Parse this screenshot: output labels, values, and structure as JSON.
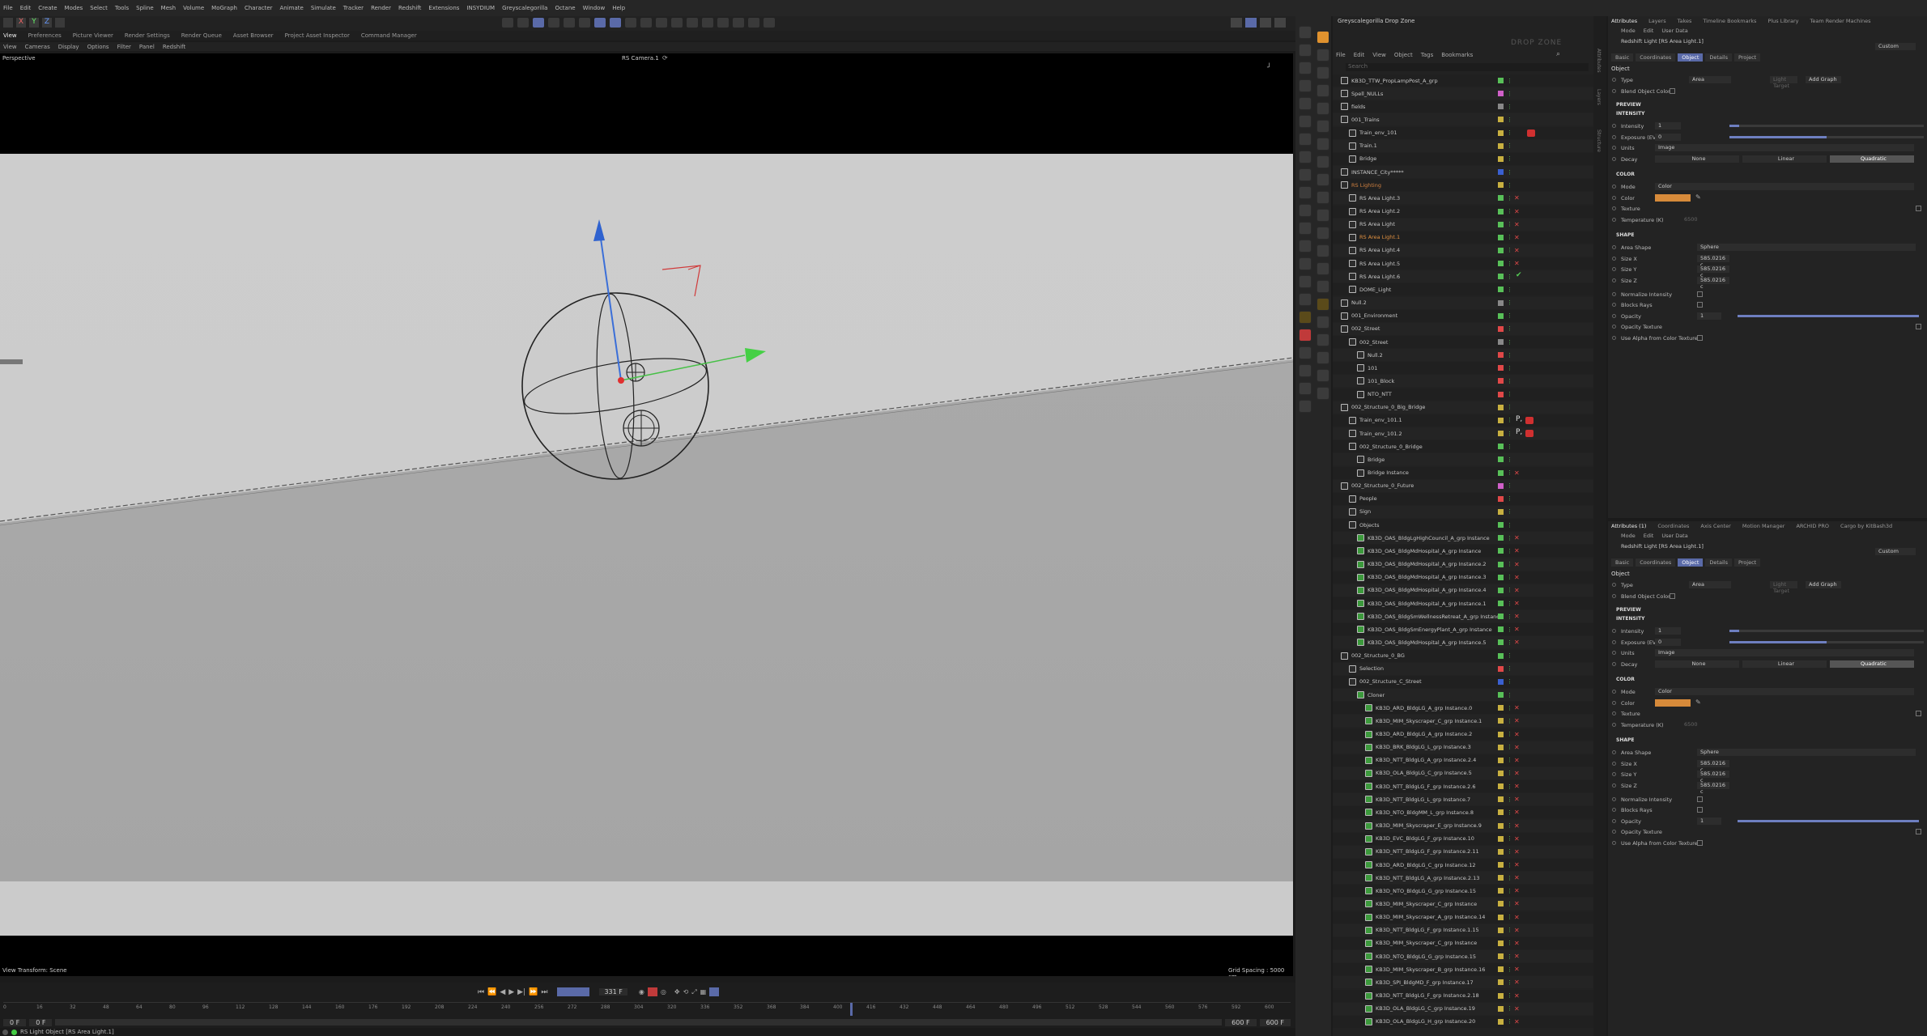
{
  "menu": [
    "File",
    "Edit",
    "Create",
    "Modes",
    "Select",
    "Tools",
    "Spline",
    "Mesh",
    "Volume",
    "MoGraph",
    "Character",
    "Animate",
    "Simulate",
    "Tracker",
    "Render",
    "Redshift",
    "Extensions",
    "INSYDIUM",
    "Greyscalegorilla",
    "Octane",
    "Window",
    "Help"
  ],
  "tabs": [
    "View",
    "Preferences",
    "Picture Viewer",
    "Render Settings",
    "Render Queue",
    "Asset Browser",
    "Project Asset Inspector",
    "Command Manager"
  ],
  "viewport": {
    "menu": [
      "View",
      "Cameras",
      "Display",
      "Options",
      "Filter",
      "Panel",
      "Redshift"
    ],
    "label": "Perspective",
    "camera": "RS Camera.1",
    "status": "View Transform: Scene",
    "grid": "Grid Spacing : 5000 cm"
  },
  "timeline": {
    "frame": "331 F",
    "ticks": [
      "0",
      "16",
      "32",
      "48",
      "64",
      "80",
      "96",
      "112",
      "128",
      "144",
      "160",
      "176",
      "192",
      "208",
      "224",
      "240",
      "256",
      "272",
      "288",
      "304",
      "320",
      "336",
      "352",
      "368",
      "384",
      "400",
      "416",
      "432",
      "448",
      "464",
      "480",
      "496",
      "512",
      "528",
      "544",
      "560",
      "576",
      "592",
      "600"
    ],
    "start": "0 F",
    "start2": "0 F",
    "end": "600 F",
    "end2": "600 F"
  },
  "statusbar": "RS Light Object [RS Area Light.1]",
  "om": {
    "title": "Greyscalegorilla Drop Zone",
    "menu": [
      "File",
      "Edit",
      "View",
      "Object",
      "Tags",
      "Bookmarks"
    ],
    "search": "Search",
    "dropzone": "DROP ZONE"
  },
  "objects": [
    {
      "n": "KB3D_TTW_PropLampPost_A_grp",
      "d": 0,
      "c": "#58c058",
      "x": false
    },
    {
      "n": "Spell_NULLs",
      "d": 0,
      "c": "#d060c8",
      "x": false
    },
    {
      "n": "fields",
      "d": 0,
      "c": "#888888",
      "x": false
    },
    {
      "n": "001_Trains",
      "d": 0,
      "c": "#c8b040",
      "x": false
    },
    {
      "n": "Train_env_101",
      "d": 1,
      "c": "#c8b040",
      "x": false
    },
    {
      "n": "Train.1",
      "d": 1,
      "c": "#c8b040",
      "x": false
    },
    {
      "n": "Bridge",
      "d": 1,
      "c": "#c8b040",
      "x": false
    },
    {
      "n": "INSTANCE_City*****",
      "d": 0,
      "c": "#3a60d0",
      "x": false
    },
    {
      "n": "RS Lighting",
      "d": 0,
      "c": "#c8b040",
      "x": false,
      "hl": "#d08040"
    },
    {
      "n": "RS Area Light.3",
      "d": 1,
      "c": "#58c058",
      "x": true
    },
    {
      "n": "RS Area Light.2",
      "d": 1,
      "c": "#58c058",
      "x": true
    },
    {
      "n": "RS Area Light",
      "d": 1,
      "c": "#58c058",
      "x": true
    },
    {
      "n": "RS Area Light.1",
      "d": 1,
      "c": "#58c058",
      "x": true,
      "hl": "#e09040"
    },
    {
      "n": "RS Area Light.4",
      "d": 1,
      "c": "#58c058",
      "x": true
    },
    {
      "n": "RS Area Light.5",
      "d": 1,
      "c": "#58c058",
      "x": true
    },
    {
      "n": "RS Area Light.6",
      "d": 1,
      "c": "#58c058",
      "x": false
    },
    {
      "n": "DOME_Light",
      "d": 1,
      "c": "#58c058",
      "x": false
    },
    {
      "n": "Null.2",
      "d": 0,
      "c": "#888888",
      "x": false
    },
    {
      "n": "001_Environment",
      "d": 0,
      "c": "#58c058",
      "x": false
    },
    {
      "n": "002_Street",
      "d": 0,
      "c": "#e04848",
      "x": false
    },
    {
      "n": "002_Street",
      "d": 1,
      "c": "#888888",
      "x": false
    },
    {
      "n": "Null.2",
      "d": 2,
      "c": "#e04848",
      "x": false
    },
    {
      "n": "101",
      "d": 2,
      "c": "#e04848",
      "x": false
    },
    {
      "n": "101_Block",
      "d": 2,
      "c": "#e04848",
      "x": false
    },
    {
      "n": "NTO_NTT",
      "d": 2,
      "c": "#e04848",
      "x": false
    },
    {
      "n": "002_Structure_0_Big_Bridge",
      "d": 0,
      "c": "#c8b040",
      "x": false
    },
    {
      "n": "Train_env_101.1",
      "d": 1,
      "c": "#c8b040",
      "x": false
    },
    {
      "n": "Train_env_101.2",
      "d": 1,
      "c": "#c8b040",
      "x": false
    },
    {
      "n": "002_Structure_0_Bridge",
      "d": 1,
      "c": "#58c058",
      "x": false
    },
    {
      "n": "Bridge",
      "d": 2,
      "c": "#58c058",
      "x": false
    },
    {
      "n": "Bridge Instance",
      "d": 2,
      "c": "#58c058",
      "x": true
    },
    {
      "n": "002_Structure_0_Future",
      "d": 0,
      "c": "#d060c8",
      "x": false
    },
    {
      "n": "People",
      "d": 1,
      "c": "#e04848",
      "x": false
    },
    {
      "n": "Sign",
      "d": 1,
      "c": "#c8b040",
      "x": false
    },
    {
      "n": "Objects",
      "d": 1,
      "c": "#58c058",
      "x": false
    },
    {
      "n": "KB3D_OAS_BldgLgHighCouncil_A_grp Instance",
      "d": 2,
      "c": "#58c058",
      "x": true
    },
    {
      "n": "KB3D_OAS_BldgMdHospital_A_grp Instance",
      "d": 2,
      "c": "#58c058",
      "x": true
    },
    {
      "n": "KB3D_OAS_BldgMdHospital_A_grp Instance.2",
      "d": 2,
      "c": "#58c058",
      "x": true
    },
    {
      "n": "KB3D_OAS_BldgMdHospital_A_grp Instance.3",
      "d": 2,
      "c": "#58c058",
      "x": true
    },
    {
      "n": "KB3D_OAS_BldgMdHospital_A_grp Instance.4",
      "d": 2,
      "c": "#58c058",
      "x": true
    },
    {
      "n": "KB3D_OAS_BldgMdHospital_A_grp Instance.1",
      "d": 2,
      "c": "#58c058",
      "x": true
    },
    {
      "n": "KB3D_OAS_BldgSmWellnessRetreat_A_grp Instance.1",
      "d": 2,
      "c": "#58c058",
      "x": true
    },
    {
      "n": "KB3D_OAS_BldgSmEnergyPlant_A_grp Instance",
      "d": 2,
      "c": "#58c058",
      "x": true
    },
    {
      "n": "KB3D_OAS_BldgMdHospital_A_grp Instance.5",
      "d": 2,
      "c": "#58c058",
      "x": true
    },
    {
      "n": "002_Structure_0_BG",
      "d": 0,
      "c": "#58c058",
      "x": false
    },
    {
      "n": "Selection",
      "d": 1,
      "c": "#e04848",
      "x": false
    },
    {
      "n": "002_Structure_C_Street",
      "d": 1,
      "c": "#3a60d0",
      "x": false
    },
    {
      "n": "Cloner",
      "d": 2,
      "c": "#58c058",
      "x": false
    },
    {
      "n": "KB3D_ARD_BldgLG_A_grp Instance.0",
      "d": 3,
      "c": "#c8b040",
      "x": true
    },
    {
      "n": "KB3D_MIM_Skyscraper_C_grp Instance.1",
      "d": 3,
      "c": "#c8b040",
      "x": true
    },
    {
      "n": "KB3D_ARD_BldgLG_A_grp Instance.2",
      "d": 3,
      "c": "#c8b040",
      "x": true
    },
    {
      "n": "KB3D_BRK_BldgLG_L_grp Instance.3",
      "d": 3,
      "c": "#c8b040",
      "x": true
    },
    {
      "n": "KB3D_NTT_BldgLG_A_grp Instance.2.4",
      "d": 3,
      "c": "#c8b040",
      "x": true
    },
    {
      "n": "KB3D_OLA_BldgLG_C_grp Instance.5",
      "d": 3,
      "c": "#c8b040",
      "x": true
    },
    {
      "n": "KB3D_NTT_BldgLG_F_grp Instance.2.6",
      "d": 3,
      "c": "#c8b040",
      "x": true
    },
    {
      "n": "KB3D_NTT_BldgLG_L_grp Instance.7",
      "d": 3,
      "c": "#c8b040",
      "x": true
    },
    {
      "n": "KB3D_NTO_BldgMM_L_grp Instance.8",
      "d": 3,
      "c": "#c8b040",
      "x": true
    },
    {
      "n": "KB3D_MIM_Skyscraper_E_grp Instance.9",
      "d": 3,
      "c": "#c8b040",
      "x": true
    },
    {
      "n": "KB3D_EVC_BldgLG_F_grp Instance.10",
      "d": 3,
      "c": "#c8b040",
      "x": true
    },
    {
      "n": "KB3D_NTT_BldgLG_F_grp Instance.2.11",
      "d": 3,
      "c": "#c8b040",
      "x": true
    },
    {
      "n": "KB3D_ARD_BldgLG_C_grp Instance.12",
      "d": 3,
      "c": "#c8b040",
      "x": true
    },
    {
      "n": "KB3D_NTT_BldgLG_A_grp Instance.2.13",
      "d": 3,
      "c": "#c8b040",
      "x": true
    },
    {
      "n": "KB3D_NTO_BldgLG_G_grp Instance.15",
      "d": 3,
      "c": "#c8b040",
      "x": true
    },
    {
      "n": "KB3D_MIM_Skyscraper_C_grp Instance",
      "d": 3,
      "c": "#c8b040",
      "x": true
    },
    {
      "n": "KB3D_MIM_Skyscraper_A_grp Instance.14",
      "d": 3,
      "c": "#c8b040",
      "x": true
    },
    {
      "n": "KB3D_NTT_BldgLG_F_grp Instance.1.15",
      "d": 3,
      "c": "#c8b040",
      "x": true
    },
    {
      "n": "KB3D_MIM_Skyscraper_C_grp Instance",
      "d": 3,
      "c": "#c8b040",
      "x": true
    },
    {
      "n": "KB3D_NTO_BldgLG_G_grp Instance.15",
      "d": 3,
      "c": "#c8b040",
      "x": true
    },
    {
      "n": "KB3D_MIM_Skyscraper_B_grp Instance.16",
      "d": 3,
      "c": "#c8b040",
      "x": true
    },
    {
      "n": "KB3D_SPI_BldgMD_F_grp Instance.17",
      "d": 3,
      "c": "#c8b040",
      "x": true
    },
    {
      "n": "KB3D_NTT_BldgLG_F_grp Instance.2.18",
      "d": 3,
      "c": "#c8b040",
      "x": true
    },
    {
      "n": "KB3D_OLA_BldgLG_C_grp Instance.19",
      "d": 3,
      "c": "#c8b040",
      "x": true
    },
    {
      "n": "KB3D_OLA_BldgLG_H_grp Instance.20",
      "d": 3,
      "c": "#c8b040",
      "x": true
    }
  ],
  "attr": {
    "tabs": [
      "Attributes",
      "Layers",
      "Takes",
      "Timeline Bookmarks",
      "Plus Library",
      "Team Render Machines"
    ],
    "tabs2": [
      "Attributes (1)",
      "Coordinates",
      "Axis Center",
      "Motion Manager",
      "ARCHID PRO",
      "Cargo by KitBash3d"
    ],
    "menu": [
      "Mode",
      "Edit",
      "User Data"
    ],
    "object_title": "Redshift Light [RS Area Light.1]",
    "custom": "Custom",
    "subtabs": [
      "Basic",
      "Coordinates",
      "Object",
      "Details",
      "Project"
    ],
    "section": "Object",
    "type_label": "Type",
    "type_value": "Area",
    "light_target": "Light Target",
    "add_graph": "Add Graph",
    "blend_label": "Blend Object Color",
    "preview": "PREVIEW",
    "intensity_h": "INTENSITY",
    "intensity_label": "Intensity",
    "intensity_value": "1",
    "intensity_level": 0.05,
    "exposure_label": "Exposure (EV)",
    "exposure_value": "0",
    "exposure_level": 0.5,
    "units_label": "Units",
    "units_value": "Image",
    "decay_label": "Decay",
    "decay_opts": [
      "None",
      "Linear",
      "Quadratic"
    ],
    "color_h": "COLOR",
    "mode_label": "Mode",
    "mode_value": "Color",
    "color_label": "Color",
    "color_hex": "#d68a3a",
    "texture_label": "Texture",
    "temp_label": "Temperature (K)",
    "temp_value": "6500",
    "shape_h": "SHAPE",
    "area_label": "Area Shape",
    "area_value": "Sphere",
    "sizex_label": "Size X",
    "sizex_value": "585.0216 c",
    "sizey_label": "Size Y",
    "sizey_value": "585.0216 c",
    "sizez_label": "Size Z",
    "sizez_value": "585.0216 c",
    "norm_label": "Normalize Intensity",
    "blocks_label": "Blocks Rays",
    "opacity_label": "Opacity",
    "opacity_value": "1",
    "opacity_level": 1,
    "optex_label": "Opacity Texture",
    "alpha_label": "Use Alpha from Color Texture"
  },
  "right_strip": [
    "Attributes",
    "Layers",
    "Structure"
  ]
}
